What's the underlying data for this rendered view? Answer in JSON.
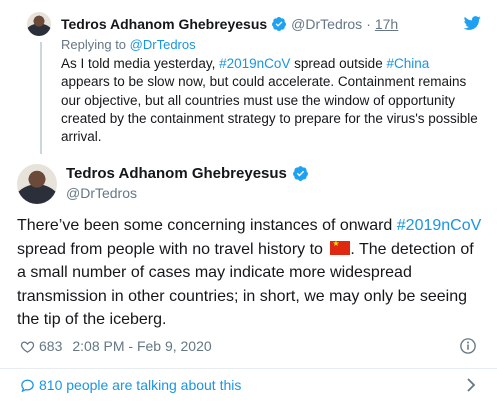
{
  "parent": {
    "name": "Tedros Adhanom Ghebreyesus",
    "handle": "@DrTedros",
    "separator": "·",
    "time": "17h",
    "replying_prefix": "Replying to",
    "replying_to": "@DrTedros",
    "text_segments": [
      {
        "t": "As I told media yesterday, ",
        "link": false
      },
      {
        "t": "#2019nCoV",
        "link": true
      },
      {
        "t": " spread outside ",
        "link": false
      },
      {
        "t": "#China",
        "link": true
      },
      {
        "t": " appears to be slow now, but could accelerate. Containment remains our objective, but all countries must use the window of opportunity created by the containment strategy to prepare for the virus's possible arrival.",
        "link": false
      }
    ]
  },
  "tweet": {
    "name": "Tedros Adhanom Ghebreyesus",
    "handle": "@DrTedros",
    "text_a": "There’ve been some concerning instances of onward ",
    "hashtag": "#2019nCoV",
    "text_b": " spread from people with no travel history to ",
    "flag": "china-flag",
    "text_c": ". The detection of a small number of cases may indicate more widespread transmission in other countries; in short, we may only be seeing the tip of the iceberg.",
    "likes": "683",
    "timestamp": "2:08 PM - Feb 9, 2020"
  },
  "footer": {
    "talking": "810 people are talking about this"
  },
  "icons": {
    "verified": "verified-badge-icon",
    "logo": "twitter-bird-icon",
    "like": "heart-icon",
    "info": "info-icon",
    "comment": "comment-icon",
    "chevron": "chevron-right-icon"
  },
  "colors": {
    "accent": "#1b95e0",
    "muted": "#657786",
    "text": "#14171a",
    "flag_red": "#de2910",
    "flag_star": "#ffde00"
  }
}
